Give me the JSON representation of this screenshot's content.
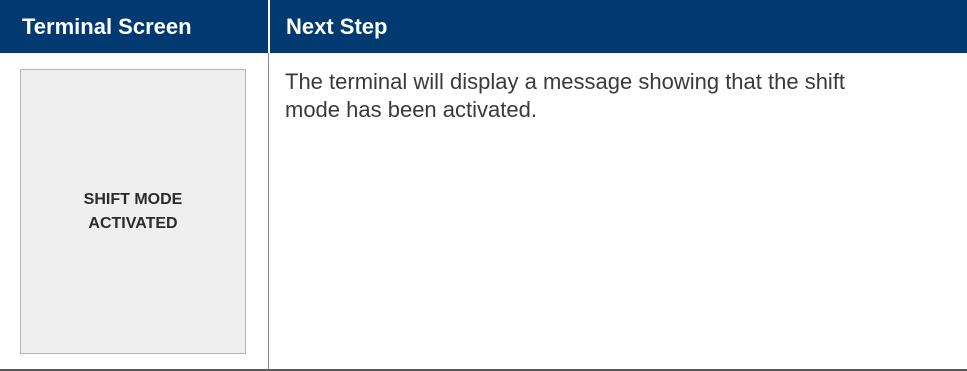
{
  "table": {
    "headers": {
      "col1": "Terminal Screen",
      "col2": "Next Step"
    },
    "row": {
      "terminal_screen": {
        "line1": "SHIFT MODE",
        "line2": "ACTIVATED"
      },
      "next_step": "The terminal will display a message showing that the shift mode has been activated."
    }
  },
  "colors": {
    "header_background": "#003a70",
    "header_text": "#ffffff",
    "screen_background": "#efefef",
    "body_text": "#3a3a3a"
  }
}
